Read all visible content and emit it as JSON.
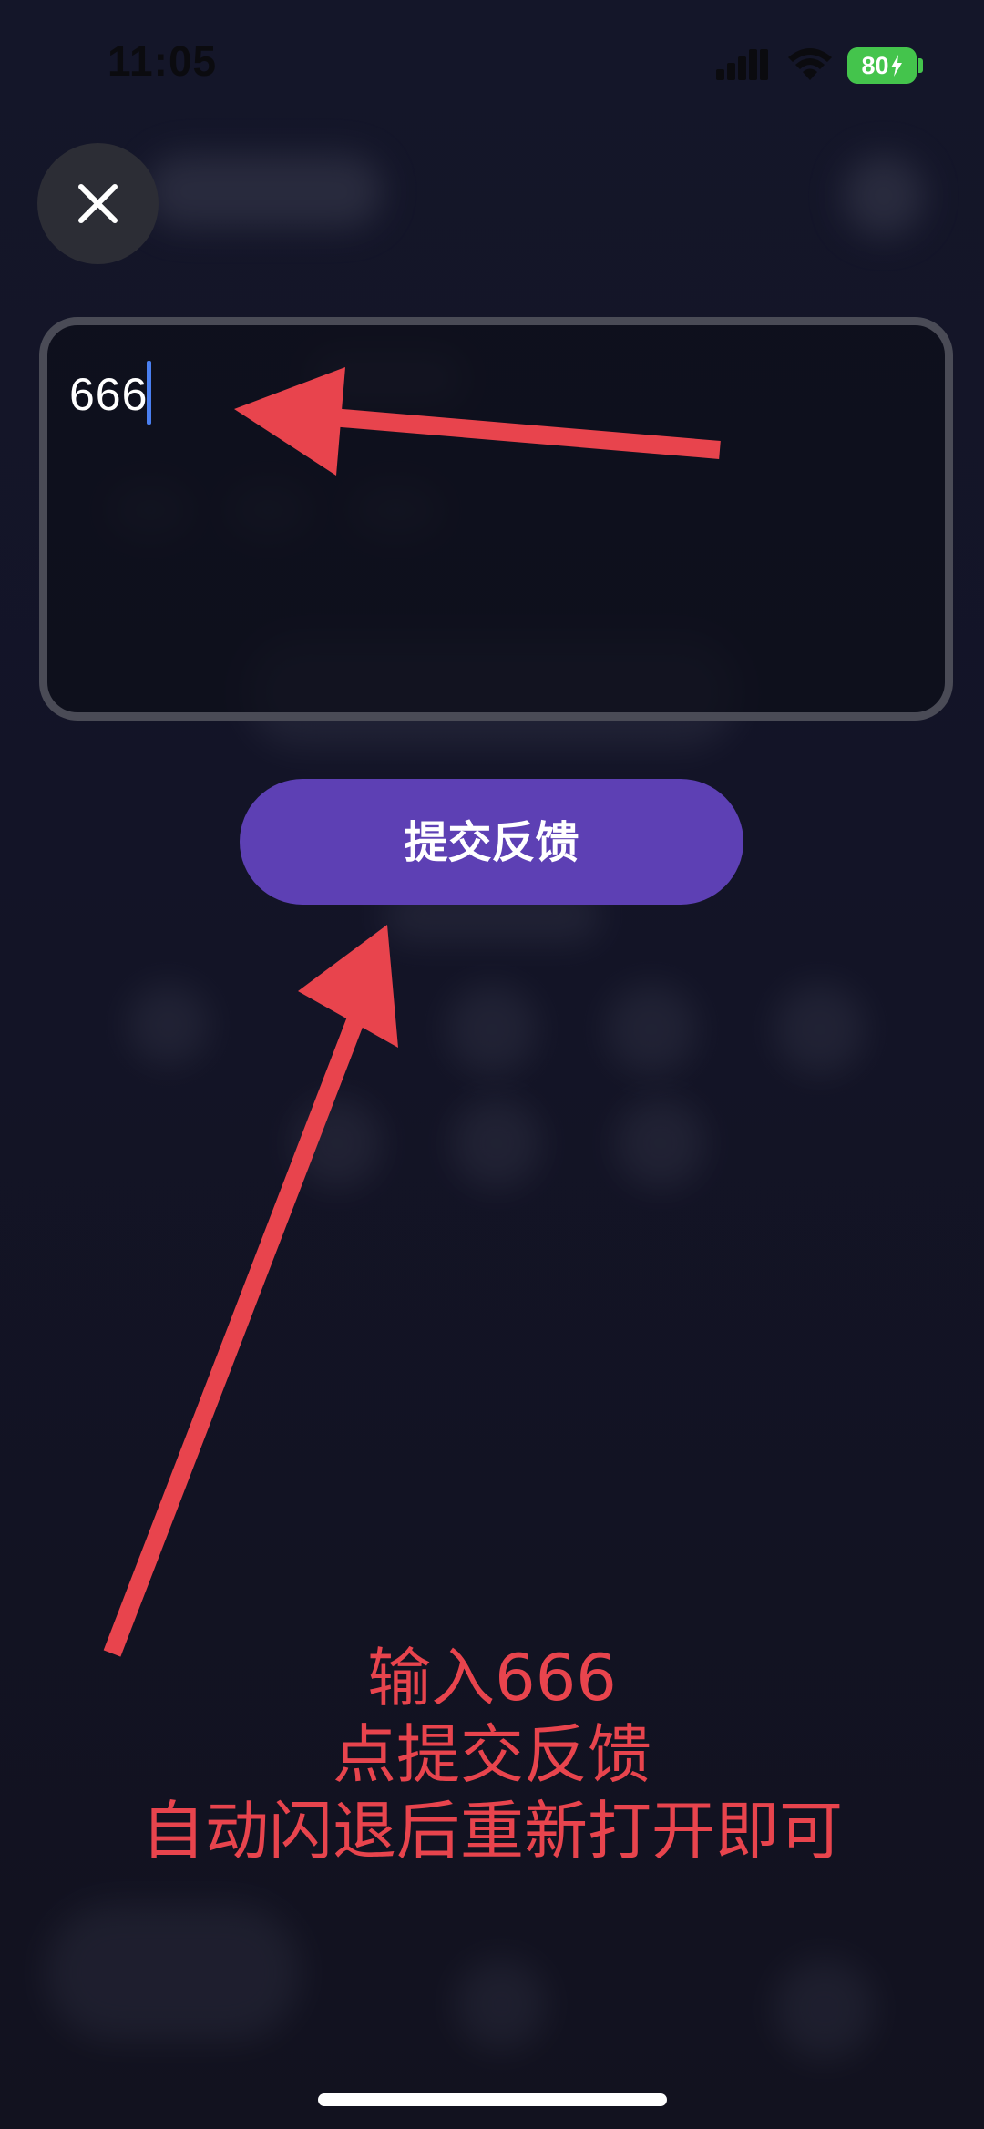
{
  "status_bar": {
    "time": "11:05",
    "battery_level": "80",
    "icons": [
      "signal-icon",
      "wifi-icon",
      "battery-icon",
      "charging-bolt-icon"
    ]
  },
  "toolbar": {
    "close_icon": "close-icon"
  },
  "feedback": {
    "value": "666"
  },
  "submit": {
    "label": "提交反馈"
  },
  "annotation": {
    "line1": "输入666",
    "line2": "点提交反馈",
    "line3": "自动闪退后重新打开即可",
    "color": "#e8444d"
  },
  "colors": {
    "background": "#131427",
    "submit_button": "#5d40b4",
    "battery": "#44c44c",
    "caret": "#4a7ff0"
  }
}
